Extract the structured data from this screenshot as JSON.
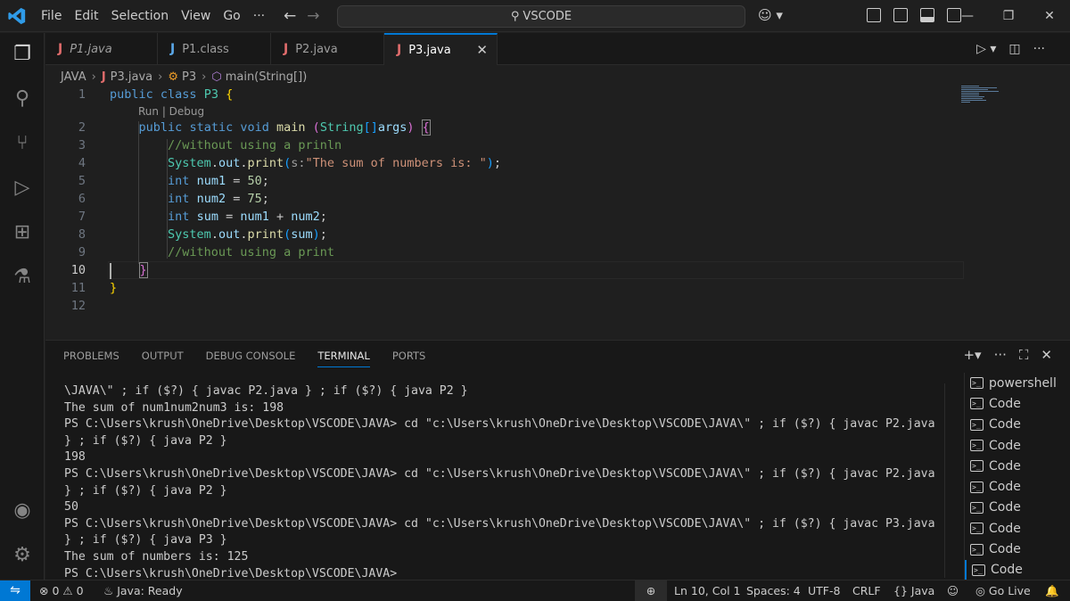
{
  "app": {
    "menu": [
      "File",
      "Edit",
      "Selection",
      "View",
      "Go",
      "···"
    ],
    "search_text": "VSCODE",
    "window_controls": [
      "—",
      "❐",
      "✕"
    ],
    "accent": "#0078d4"
  },
  "tabs": [
    {
      "icon": "J",
      "label": "P1.java",
      "active": false
    },
    {
      "icon": "J",
      "label": "P1.class",
      "active": false
    },
    {
      "icon": "J",
      "label": "P2.java",
      "active": false
    },
    {
      "icon": "J",
      "label": "P3.java",
      "active": true
    }
  ],
  "breadcrumb": {
    "folder": "JAVA",
    "file": "P3.java",
    "class": "P3",
    "method": "main(String[])"
  },
  "editor": {
    "line_numbers": [
      "1",
      "2",
      "3",
      "4",
      "5",
      "6",
      "7",
      "8",
      "9",
      "10",
      "11",
      "12"
    ],
    "codelens": "Run | Debug",
    "current_line": "10"
  },
  "panel": {
    "tabs": [
      "PROBLEMS",
      "OUTPUT",
      "DEBUG CONSOLE",
      "TERMINAL",
      "PORTS"
    ],
    "active_tab": "TERMINAL",
    "terminal_lines": [
      "\\JAVA\\\" ; if ($?) { javac P2.java } ; if ($?) { java P2 }",
      "The sum of num1num2num3 is: 198",
      "PS C:\\Users\\krush\\OneDrive\\Desktop\\VSCODE\\JAVA> cd \"c:\\Users\\krush\\OneDrive\\Desktop\\VSCODE\\JAVA\\\" ; if ($?) { javac P2.java",
      "} ; if ($?) { java P2 }",
      "198",
      "PS C:\\Users\\krush\\OneDrive\\Desktop\\VSCODE\\JAVA> cd \"c:\\Users\\krush\\OneDrive\\Desktop\\VSCODE\\JAVA\\\" ; if ($?) { javac P2.java",
      "} ; if ($?) { java P2 }",
      "50",
      "PS C:\\Users\\krush\\OneDrive\\Desktop\\VSCODE\\JAVA> cd \"c:\\Users\\krush\\OneDrive\\Desktop\\VSCODE\\JAVA\\\" ; if ($?) { javac P3.java",
      "} ; if ($?) { java P3 }",
      "The sum of numbers is: 125",
      "PS C:\\Users\\krush\\OneDrive\\Desktop\\VSCODE\\JAVA>"
    ],
    "terminal_sessions": [
      "powershell",
      "Code",
      "Code",
      "Code",
      "Code",
      "Code",
      "Code",
      "Code",
      "Code",
      "Code"
    ]
  },
  "status": {
    "remote_icon": "remote-icon",
    "errors": "0",
    "warnings": "0",
    "java": "Java: Ready",
    "position": "Ln 10, Col 1",
    "spaces": "Spaces: 4",
    "encoding": "UTF-8",
    "eol": "CRLF",
    "language": "Java",
    "golive": "Go Live"
  }
}
